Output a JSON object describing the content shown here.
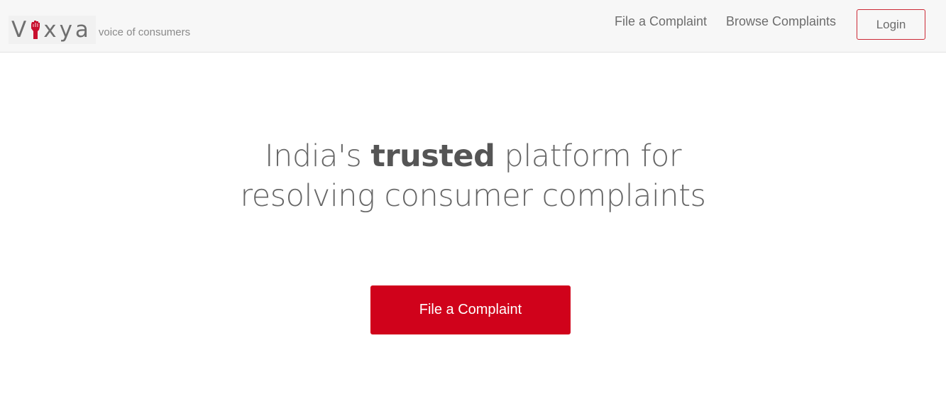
{
  "brand": {
    "logo_prefix": "V",
    "logo_suffix": "xya",
    "logo_icon": "raised-fist-icon",
    "tagline": "voice of consumers",
    "accent_color": "#d0021b"
  },
  "nav": {
    "file_complaint": "File a Complaint",
    "browse_complaints": "Browse Complaints",
    "login": "Login"
  },
  "hero": {
    "title_part1": "India's ",
    "title_strong": "trusted",
    "title_part2": " platform for resolving consumer complaints",
    "cta_label": "File a Complaint"
  }
}
